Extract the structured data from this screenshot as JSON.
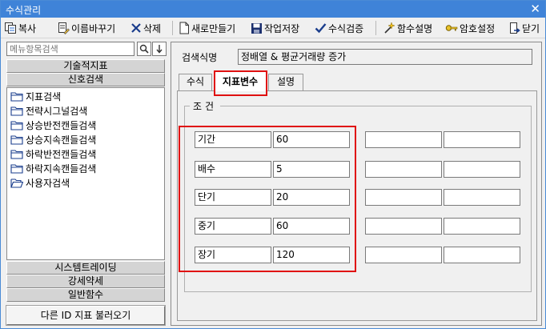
{
  "window": {
    "title": "수식관리",
    "close": "✕"
  },
  "toolbar": {
    "copy": "복사",
    "rename": "이름바꾸기",
    "delete": "삭제",
    "new": "새로만들기",
    "save": "작업저장",
    "verify": "수식검증",
    "func_help": "함수설명",
    "password": "암호설정",
    "close": "닫기"
  },
  "search": {
    "placeholder": "메뉴항목검색"
  },
  "categories": {
    "technical": "기술적지표",
    "signal": "신호검색",
    "system": "시스템트레이딩",
    "strong_weak": "강세약세",
    "general_func": "일반함수"
  },
  "tree": [
    "지표검색",
    "전략시그널검색",
    "상승반전캔들검색",
    "상승지속캔들검색",
    "하락반전캔들검색",
    "하락지속캔들검색",
    "사용자검색"
  ],
  "load_other_id": "다른 ID 지표 불러오기",
  "formula": {
    "name_label": "검색식명",
    "name_value": "정배열 & 평균거래량 증가"
  },
  "tabs": [
    "수식",
    "지표변수",
    "설명"
  ],
  "condition": {
    "title": "조건"
  },
  "variables": [
    {
      "name": "기간",
      "value": "60"
    },
    {
      "name": "배수",
      "value": "5"
    },
    {
      "name": "단기",
      "value": "20"
    },
    {
      "name": "중기",
      "value": "60"
    },
    {
      "name": "장기",
      "value": "120"
    }
  ]
}
